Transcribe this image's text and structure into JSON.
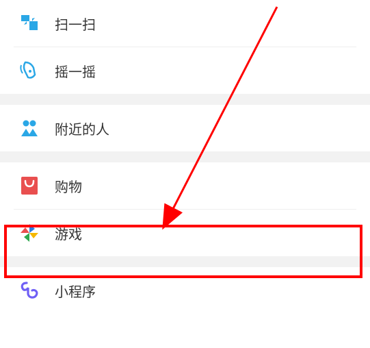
{
  "menu": {
    "scan": {
      "label": "扫一扫"
    },
    "shake": {
      "label": "摇一摇"
    },
    "nearby": {
      "label": "附近的人"
    },
    "shopping": {
      "label": "购物"
    },
    "games": {
      "label": "游戏"
    },
    "miniprogram": {
      "label": "小程序"
    }
  },
  "annotation": {
    "highlight_target": "games",
    "arrow_color": "#ff0000",
    "box_color": "#ff0000"
  }
}
